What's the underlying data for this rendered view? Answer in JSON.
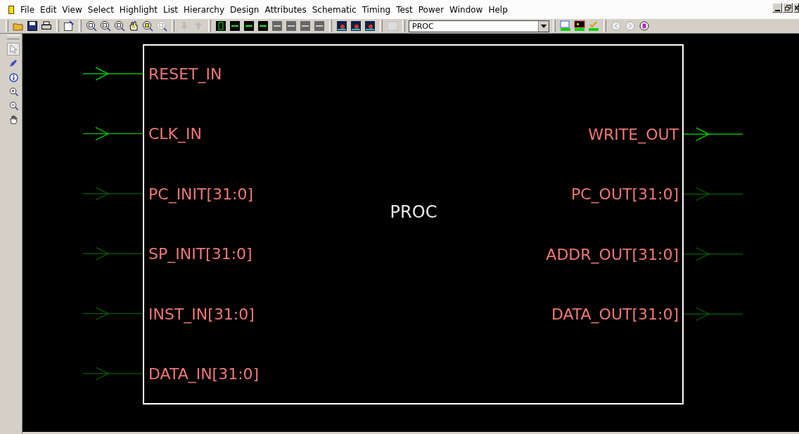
{
  "menu_bar": [
    {
      "label": "File"
    },
    {
      "label": "Edit"
    },
    {
      "label": "View"
    },
    {
      "label": "Select"
    },
    {
      "label": "Highlight"
    },
    {
      "label": "List"
    },
    {
      "label": "Hierarchy"
    },
    {
      "label": "Design"
    },
    {
      "label": "Attributes"
    },
    {
      "label": "Schematic"
    },
    {
      "label": "Timing"
    },
    {
      "label": "Test"
    },
    {
      "label": "Power"
    },
    {
      "label": "Window"
    },
    {
      "label": "Help"
    }
  ],
  "toolbar": {
    "design_select": {
      "value": "PROC"
    }
  },
  "schematic": {
    "block": {
      "name": "PROC"
    },
    "inputs": [
      {
        "name": "RESET_IN",
        "kind": "wire"
      },
      {
        "name": "CLK_IN",
        "kind": "wire"
      },
      {
        "name": "PC_INIT[31:0]",
        "kind": "bus"
      },
      {
        "name": "SP_INIT[31:0]",
        "kind": "bus"
      },
      {
        "name": "INST_IN[31:0]",
        "kind": "bus"
      },
      {
        "name": "DATA_IN[31:0]",
        "kind": "bus"
      }
    ],
    "outputs": [
      {
        "name": "WRITE_OUT",
        "kind": "wire"
      },
      {
        "name": "PC_OUT[31:0]",
        "kind": "bus"
      },
      {
        "name": "ADDR_OUT[31:0]",
        "kind": "bus"
      },
      {
        "name": "DATA_OUT[31:0]",
        "kind": "bus"
      }
    ]
  }
}
